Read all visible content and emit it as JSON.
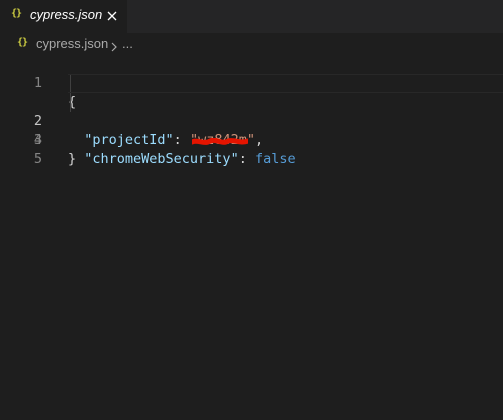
{
  "tab": {
    "icon": "{}",
    "icon_name": "json-braces-icon",
    "label": "cypress.json",
    "close_icon": "close-icon"
  },
  "breadcrumb": {
    "icon": "{}",
    "file": "cypress.json",
    "separator_icon": "chevron-right-icon",
    "more": "..."
  },
  "code": {
    "lines": [
      {
        "number": "1",
        "text": "{"
      },
      {
        "number": "2",
        "key": "\"projectId\"",
        "colon": ": ",
        "value": "\"wz842m\"",
        "trail": ","
      },
      {
        "number": "3",
        "key": "\"chromeWebSecurity\"",
        "colon": ": ",
        "value": "false"
      },
      {
        "number": "4",
        "text": "}"
      },
      {
        "number": "5",
        "text": ""
      }
    ],
    "current_line": "2"
  },
  "colors": {
    "background": "#1e1e1e",
    "tab_bar": "#252526",
    "key": "#9cdcfe",
    "string": "#ce9178",
    "keyword": "#569cd6",
    "redaction": "#e51400"
  }
}
